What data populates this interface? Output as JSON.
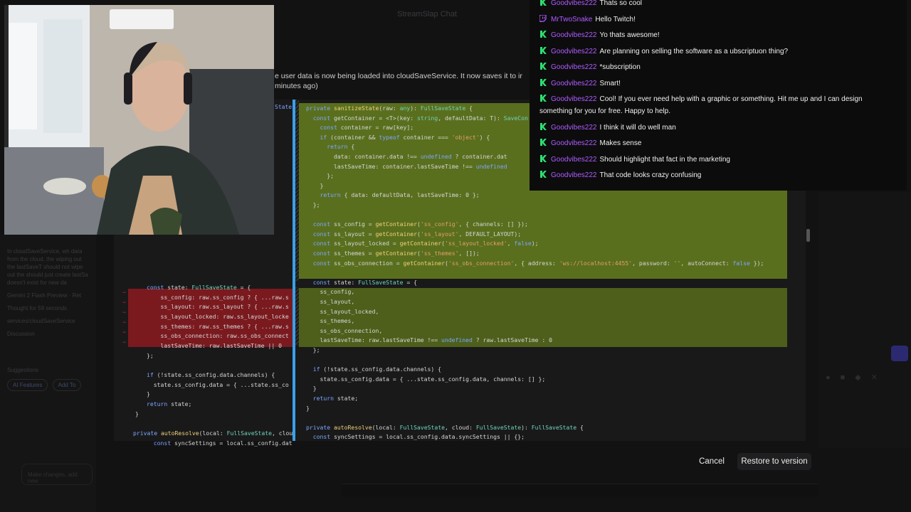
{
  "dialog": {
    "title": "StreamSlap Chat",
    "message_line1": "e user data is now being loaded into cloudSaveService. It now saves it to ir",
    "message_line2": "minutes ago)",
    "buttons": {
      "cancel": "Cancel",
      "restore": "Restore to version"
    }
  },
  "background_sidebar": {
    "paragraph": "In cloudSaveService, wh data from the cloud, the wiping out the lastSaveT should not wipe out the should just create lastSa doesn't exist for new da",
    "meta": "Gemini 2 Flash Preview · Ret",
    "thought": "Thought for 59 seconds",
    "file": "services/cloudSaveService",
    "discussion": "Discussion",
    "suggestions": "Suggestions",
    "ai_features": "AI Features",
    "add_to": "Add To",
    "input_placeholder": "Make changes, add new"
  },
  "chat": {
    "colors": {
      "twitch_user": "#b05cff",
      "badge": "#2fdc70",
      "text": "#f0f0f0"
    },
    "messages": [
      {
        "user": "Goodvibes222",
        "text": "Thats so cool",
        "badge": "k-icon"
      },
      {
        "user": "MrTwoSnake",
        "text": "Hello Twitch!",
        "badge": "twitch-icon"
      },
      {
        "user": "Goodvibes222",
        "text": "Yo thats awesome!",
        "badge": "k-icon"
      },
      {
        "user": "Goodvibes222",
        "text": "Are planning on selling the software as a ubscriptuon thing?",
        "badge": "k-icon"
      },
      {
        "user": "Goodvibes222",
        "text": "*subscription",
        "badge": "k-icon"
      },
      {
        "user": "Goodvibes222",
        "text": "Smart!",
        "badge": "k-icon"
      },
      {
        "user": "Goodvibes222",
        "text": "Cool! If you ever need help with a graphic or something. Hit me up and I can design",
        "text2": "something for you for free. Happy to help.",
        "badge": "k-icon"
      },
      {
        "user": "Goodvibes222",
        "text": "I think it will do well man",
        "badge": "k-icon"
      },
      {
        "user": "Goodvibes222",
        "text": "Makes sense",
        "badge": "k-icon"
      },
      {
        "user": "Goodvibes222",
        "text": "Should highlight that fact in the marketing",
        "badge": "k-icon"
      },
      {
        "user": "Goodvibes222",
        "text": "That code looks crazy confusing",
        "badge": "k-icon"
      }
    ]
  },
  "code_left": {
    "state_label": "State",
    "lines": [
      "const state: FullSaveState = {",
      "    ss_config: raw.ss_config ? { ...raw.s",
      "    ss_layout: raw.ss_layout ? { ...raw.s",
      "    ss_layout_locked: raw.ss_layout_locke",
      "    ss_themes: raw.ss_themes ? { ...raw.s",
      "    ss_obs_connection: raw.ss_obs_connect",
      "    lastSaveTime: raw.lastSaveTime || 0",
      "};",
      "",
      "if (!state.ss_config.data.channels) {",
      "  state.ss_config.data = { ...state.ss_co",
      "}",
      "return state;",
      "}",
      "",
      "private autoResolve(local: FullSaveState, cloud",
      "  const syncSettings = local.ss_config.data.s"
    ]
  },
  "code_right": {
    "lines": [
      "private sanitizeState(raw: any): FullSaveState {",
      "  const getContainer = <T>(key: string, defaultData: T): SaveCon",
      "    const container = raw[key];",
      "    if (container && typeof container === 'object') {",
      "      return {",
      "        data: container.data !== undefined ? container.dat",
      "        lastSaveTime: container.lastSaveTime !== undefined",
      "      };",
      "    }",
      "    return { data: defaultData, lastSaveTime: 0 };",
      "  };",
      "",
      "  const ss_config = getContainer('ss_config', { channels: [] });",
      "  const ss_layout = getContainer('ss_layout', DEFAULT_LAYOUT);",
      "  const ss_layout_locked = getContainer('ss_layout_locked', false);",
      "  const ss_themes = getContainer('ss_themes', []);",
      "  const ss_obs_connection = getContainer('ss_obs_connection', { address: 'ws://localhost:4455', password: '', autoConnect: false });",
      "",
      "  const state: FullSaveState = {",
      "    ss_config,",
      "    ss_layout,",
      "    ss_layout_locked,",
      "    ss_themes,",
      "    ss_obs_connection,",
      "    lastSaveTime: raw.lastSaveTime !== undefined ? raw.lastSaveTime : 0",
      "  };",
      "",
      "  if (!state.ss_config.data.channels) {",
      "    state.ss_config.data = { ...state.ss_config.data, channels: [] };",
      "  }",
      "  return state;",
      "}",
      "",
      "private autoResolve(local: FullSaveState, cloud: FullSaveState): FullSaveState {",
      "  const syncSettings = local.ss_config.data.syncSettings || {};"
    ]
  }
}
